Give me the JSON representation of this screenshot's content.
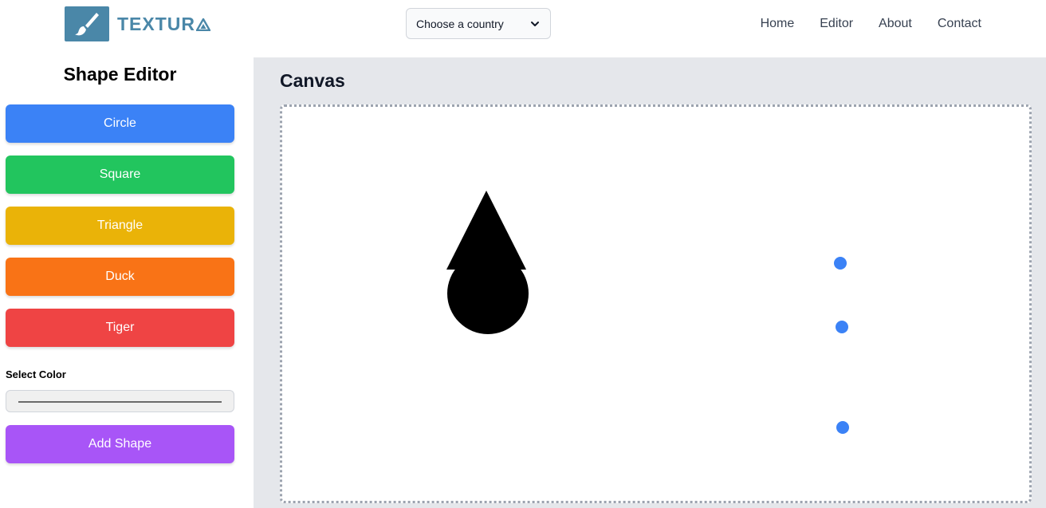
{
  "header": {
    "logo_text": "TEXTUR",
    "country_select": {
      "value": "Choose a country"
    },
    "nav": [
      "Home",
      "Editor",
      "About",
      "Contact"
    ]
  },
  "sidebar": {
    "title": "Shape Editor",
    "shape_buttons": [
      {
        "label": "Circle",
        "color": "#3b82f6"
      },
      {
        "label": "Square",
        "color": "#22c55e"
      },
      {
        "label": "Triangle",
        "color": "#eab308"
      },
      {
        "label": "Duck",
        "color": "#f97316"
      },
      {
        "label": "Tiger",
        "color": "#ef4444"
      }
    ],
    "color_label": "Select Color",
    "add_button": {
      "label": "Add Shape",
      "color": "#a855f7"
    }
  },
  "main": {
    "canvas_title": "Canvas",
    "shapes": [
      {
        "type": "triangle",
        "color": "#000000"
      },
      {
        "type": "circle",
        "color": "#000000"
      }
    ],
    "handles_color": "#3b82f6"
  }
}
